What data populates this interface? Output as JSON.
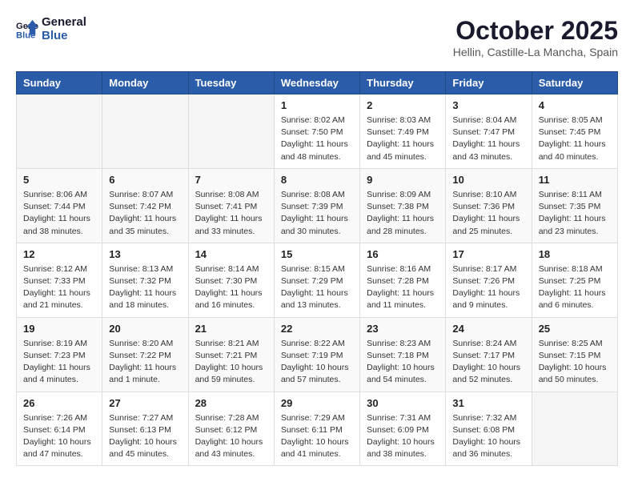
{
  "header": {
    "logo_text_general": "General",
    "logo_text_blue": "Blue",
    "month": "October 2025",
    "location": "Hellin, Castille-La Mancha, Spain"
  },
  "weekdays": [
    "Sunday",
    "Monday",
    "Tuesday",
    "Wednesday",
    "Thursday",
    "Friday",
    "Saturday"
  ],
  "weeks": [
    [
      {
        "day": "",
        "sunrise": "",
        "sunset": "",
        "daylight": ""
      },
      {
        "day": "",
        "sunrise": "",
        "sunset": "",
        "daylight": ""
      },
      {
        "day": "",
        "sunrise": "",
        "sunset": "",
        "daylight": ""
      },
      {
        "day": "1",
        "sunrise": "Sunrise: 8:02 AM",
        "sunset": "Sunset: 7:50 PM",
        "daylight": "Daylight: 11 hours and 48 minutes."
      },
      {
        "day": "2",
        "sunrise": "Sunrise: 8:03 AM",
        "sunset": "Sunset: 7:49 PM",
        "daylight": "Daylight: 11 hours and 45 minutes."
      },
      {
        "day": "3",
        "sunrise": "Sunrise: 8:04 AM",
        "sunset": "Sunset: 7:47 PM",
        "daylight": "Daylight: 11 hours and 43 minutes."
      },
      {
        "day": "4",
        "sunrise": "Sunrise: 8:05 AM",
        "sunset": "Sunset: 7:45 PM",
        "daylight": "Daylight: 11 hours and 40 minutes."
      }
    ],
    [
      {
        "day": "5",
        "sunrise": "Sunrise: 8:06 AM",
        "sunset": "Sunset: 7:44 PM",
        "daylight": "Daylight: 11 hours and 38 minutes."
      },
      {
        "day": "6",
        "sunrise": "Sunrise: 8:07 AM",
        "sunset": "Sunset: 7:42 PM",
        "daylight": "Daylight: 11 hours and 35 minutes."
      },
      {
        "day": "7",
        "sunrise": "Sunrise: 8:08 AM",
        "sunset": "Sunset: 7:41 PM",
        "daylight": "Daylight: 11 hours and 33 minutes."
      },
      {
        "day": "8",
        "sunrise": "Sunrise: 8:08 AM",
        "sunset": "Sunset: 7:39 PM",
        "daylight": "Daylight: 11 hours and 30 minutes."
      },
      {
        "day": "9",
        "sunrise": "Sunrise: 8:09 AM",
        "sunset": "Sunset: 7:38 PM",
        "daylight": "Daylight: 11 hours and 28 minutes."
      },
      {
        "day": "10",
        "sunrise": "Sunrise: 8:10 AM",
        "sunset": "Sunset: 7:36 PM",
        "daylight": "Daylight: 11 hours and 25 minutes."
      },
      {
        "day": "11",
        "sunrise": "Sunrise: 8:11 AM",
        "sunset": "Sunset: 7:35 PM",
        "daylight": "Daylight: 11 hours and 23 minutes."
      }
    ],
    [
      {
        "day": "12",
        "sunrise": "Sunrise: 8:12 AM",
        "sunset": "Sunset: 7:33 PM",
        "daylight": "Daylight: 11 hours and 21 minutes."
      },
      {
        "day": "13",
        "sunrise": "Sunrise: 8:13 AM",
        "sunset": "Sunset: 7:32 PM",
        "daylight": "Daylight: 11 hours and 18 minutes."
      },
      {
        "day": "14",
        "sunrise": "Sunrise: 8:14 AM",
        "sunset": "Sunset: 7:30 PM",
        "daylight": "Daylight: 11 hours and 16 minutes."
      },
      {
        "day": "15",
        "sunrise": "Sunrise: 8:15 AM",
        "sunset": "Sunset: 7:29 PM",
        "daylight": "Daylight: 11 hours and 13 minutes."
      },
      {
        "day": "16",
        "sunrise": "Sunrise: 8:16 AM",
        "sunset": "Sunset: 7:28 PM",
        "daylight": "Daylight: 11 hours and 11 minutes."
      },
      {
        "day": "17",
        "sunrise": "Sunrise: 8:17 AM",
        "sunset": "Sunset: 7:26 PM",
        "daylight": "Daylight: 11 hours and 9 minutes."
      },
      {
        "day": "18",
        "sunrise": "Sunrise: 8:18 AM",
        "sunset": "Sunset: 7:25 PM",
        "daylight": "Daylight: 11 hours and 6 minutes."
      }
    ],
    [
      {
        "day": "19",
        "sunrise": "Sunrise: 8:19 AM",
        "sunset": "Sunset: 7:23 PM",
        "daylight": "Daylight: 11 hours and 4 minutes."
      },
      {
        "day": "20",
        "sunrise": "Sunrise: 8:20 AM",
        "sunset": "Sunset: 7:22 PM",
        "daylight": "Daylight: 11 hours and 1 minute."
      },
      {
        "day": "21",
        "sunrise": "Sunrise: 8:21 AM",
        "sunset": "Sunset: 7:21 PM",
        "daylight": "Daylight: 10 hours and 59 minutes."
      },
      {
        "day": "22",
        "sunrise": "Sunrise: 8:22 AM",
        "sunset": "Sunset: 7:19 PM",
        "daylight": "Daylight: 10 hours and 57 minutes."
      },
      {
        "day": "23",
        "sunrise": "Sunrise: 8:23 AM",
        "sunset": "Sunset: 7:18 PM",
        "daylight": "Daylight: 10 hours and 54 minutes."
      },
      {
        "day": "24",
        "sunrise": "Sunrise: 8:24 AM",
        "sunset": "Sunset: 7:17 PM",
        "daylight": "Daylight: 10 hours and 52 minutes."
      },
      {
        "day": "25",
        "sunrise": "Sunrise: 8:25 AM",
        "sunset": "Sunset: 7:15 PM",
        "daylight": "Daylight: 10 hours and 50 minutes."
      }
    ],
    [
      {
        "day": "26",
        "sunrise": "Sunrise: 7:26 AM",
        "sunset": "Sunset: 6:14 PM",
        "daylight": "Daylight: 10 hours and 47 minutes."
      },
      {
        "day": "27",
        "sunrise": "Sunrise: 7:27 AM",
        "sunset": "Sunset: 6:13 PM",
        "daylight": "Daylight: 10 hours and 45 minutes."
      },
      {
        "day": "28",
        "sunrise": "Sunrise: 7:28 AM",
        "sunset": "Sunset: 6:12 PM",
        "daylight": "Daylight: 10 hours and 43 minutes."
      },
      {
        "day": "29",
        "sunrise": "Sunrise: 7:29 AM",
        "sunset": "Sunset: 6:11 PM",
        "daylight": "Daylight: 10 hours and 41 minutes."
      },
      {
        "day": "30",
        "sunrise": "Sunrise: 7:31 AM",
        "sunset": "Sunset: 6:09 PM",
        "daylight": "Daylight: 10 hours and 38 minutes."
      },
      {
        "day": "31",
        "sunrise": "Sunrise: 7:32 AM",
        "sunset": "Sunset: 6:08 PM",
        "daylight": "Daylight: 10 hours and 36 minutes."
      },
      {
        "day": "",
        "sunrise": "",
        "sunset": "",
        "daylight": ""
      }
    ]
  ]
}
